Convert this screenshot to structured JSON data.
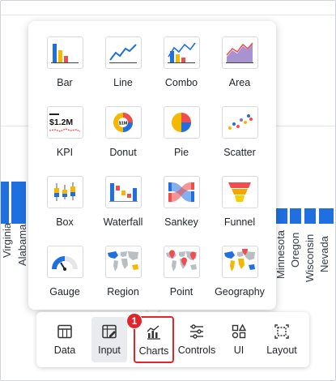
{
  "background": {
    "left_labels": [
      "Virginia",
      "Alabama"
    ],
    "right_labels": [
      "Minnesota",
      "Oregon",
      "Wisconsin",
      "Nevada"
    ]
  },
  "chart_picker": {
    "items": [
      {
        "label": "Bar",
        "icon": "bar-chart-icon"
      },
      {
        "label": "Line",
        "icon": "line-chart-icon"
      },
      {
        "label": "Combo",
        "icon": "combo-chart-icon"
      },
      {
        "label": "Area",
        "icon": "area-chart-icon"
      },
      {
        "label": "KPI",
        "icon": "kpi-icon",
        "value_text": "$1.2M"
      },
      {
        "label": "Donut",
        "icon": "donut-chart-icon",
        "center_text": "$1M"
      },
      {
        "label": "Pie",
        "icon": "pie-chart-icon"
      },
      {
        "label": "Scatter",
        "icon": "scatter-chart-icon"
      },
      {
        "label": "Box",
        "icon": "box-plot-icon"
      },
      {
        "label": "Waterfall",
        "icon": "waterfall-chart-icon"
      },
      {
        "label": "Sankey",
        "icon": "sankey-chart-icon"
      },
      {
        "label": "Funnel",
        "icon": "funnel-chart-icon"
      },
      {
        "label": "Gauge",
        "icon": "gauge-chart-icon"
      },
      {
        "label": "Region",
        "icon": "region-map-icon"
      },
      {
        "label": "Point",
        "icon": "point-map-icon"
      },
      {
        "label": "Geography",
        "icon": "geography-map-icon"
      }
    ]
  },
  "toolbar": {
    "items": [
      {
        "label": "Data",
        "icon": "table-icon"
      },
      {
        "label": "Input",
        "icon": "input-edit-icon"
      },
      {
        "label": "Charts",
        "icon": "charts-icon"
      },
      {
        "label": "Controls",
        "icon": "sliders-icon"
      },
      {
        "label": "UI",
        "icon": "ui-elements-icon"
      },
      {
        "label": "Layout",
        "icon": "layout-icon"
      }
    ],
    "badge": "1"
  },
  "colors": {
    "accent_blue": "#1f6fe0",
    "highlight_red": "#e3242b",
    "chart_yellow": "#f5b800",
    "chart_red": "#f04e4e",
    "chart_purple": "#8a6fbf"
  }
}
